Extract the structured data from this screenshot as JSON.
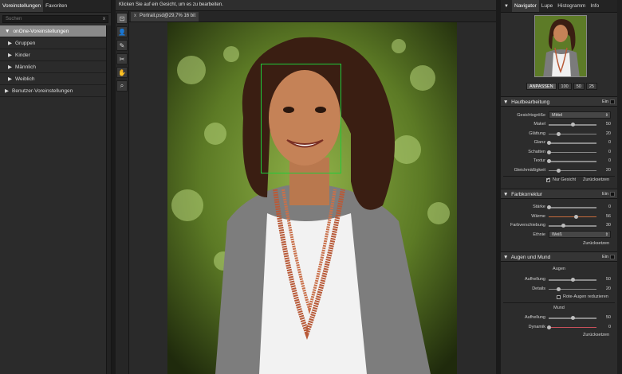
{
  "left_panel": {
    "tabs": [
      "Voreinstellungen",
      "Favoriten"
    ],
    "search_placeholder": "Suchen",
    "search_clear": "x",
    "rows": [
      {
        "label": "onOne-Voreinstellungen",
        "arrow": "▼",
        "selected": true,
        "level": 0
      },
      {
        "label": "Gruppen",
        "arrow": "▶",
        "level": 1
      },
      {
        "label": "Kinder",
        "arrow": "▶",
        "level": 1
      },
      {
        "label": "Männlich",
        "arrow": "▶",
        "level": 1
      },
      {
        "label": "Weiblich",
        "arrow": "▶",
        "level": 1
      },
      {
        "label": "Benutzer-Voreinstellungen",
        "arrow": "▶",
        "level": 0
      }
    ]
  },
  "topbar": {
    "hint": "Klicken Sie auf ein Gesicht, um es zu bearbeiten."
  },
  "doc_tab": {
    "close": "x",
    "label": "Portrait.psd@29,7% 16 bit"
  },
  "tools": [
    {
      "icon": "face-select-icon",
      "glyph": "⊡"
    },
    {
      "icon": "portrait-icon",
      "glyph": "👤"
    },
    {
      "icon": "eraser-icon",
      "glyph": "✎"
    },
    {
      "icon": "brush-icon",
      "glyph": "✂"
    },
    {
      "icon": "hand-icon",
      "glyph": "✋"
    },
    {
      "icon": "zoom-icon",
      "glyph": "⌕"
    }
  ],
  "right_panel": {
    "tabs": [
      "Navigator",
      "Lupe",
      "Histogramm",
      "Info"
    ],
    "zoom_buttons": [
      "ANPASSEN",
      "100",
      "50",
      "25"
    ],
    "sections": {
      "haut": {
        "title": "Hautbearbeitung",
        "on": "Ein",
        "size_label": "Gesichtsgröße",
        "size_value": "Mittel",
        "sliders": [
          {
            "label": "Makel",
            "value": "50",
            "pos": 0.5
          },
          {
            "label": "Glättung",
            "value": "20",
            "pos": 0.2
          },
          {
            "label": "Glanz",
            "value": "0",
            "pos": 0.0
          },
          {
            "label": "Schatten",
            "value": "0",
            "pos": 0.0
          },
          {
            "label": "Textur",
            "value": "0",
            "pos": 0.0
          },
          {
            "label": "Gleichmäßigkeit",
            "value": "20",
            "pos": 0.2
          }
        ],
        "checkbox": "Nur Gesicht",
        "reset": "Zurücksetzen"
      },
      "farb": {
        "title": "Farbkorrektur",
        "on": "Ein",
        "sliders": [
          {
            "label": "Stärke",
            "value": "0",
            "pos": 0.0
          },
          {
            "label": "Wärme",
            "value": "56",
            "pos": 0.56
          },
          {
            "label": "Farbverschiebung",
            "value": "30",
            "pos": 0.3
          }
        ],
        "ethnie_label": "Ethnie",
        "ethnie_value": "Weiß",
        "reset": "Zurücksetzen"
      },
      "augen": {
        "title": "Augen und Mund",
        "on": "Ein",
        "eyes_header": "Augen",
        "eye_sliders": [
          {
            "label": "Aufhellung",
            "value": "50",
            "pos": 0.5
          },
          {
            "label": "Details",
            "value": "20",
            "pos": 0.2
          }
        ],
        "checkbox": "Rote-Augen reduzieren",
        "mouth_header": "Mund",
        "mouth_sliders": [
          {
            "label": "Aufhellung",
            "value": "50",
            "pos": 0.5
          },
          {
            "label": "Dynamik",
            "value": "0",
            "pos": 0.0
          }
        ],
        "reset": "Zurücksetzen"
      }
    }
  },
  "colors": {
    "face_box": "#1fcc3a",
    "warm_track": "#c86b3c",
    "red_track": "#c8505a"
  }
}
